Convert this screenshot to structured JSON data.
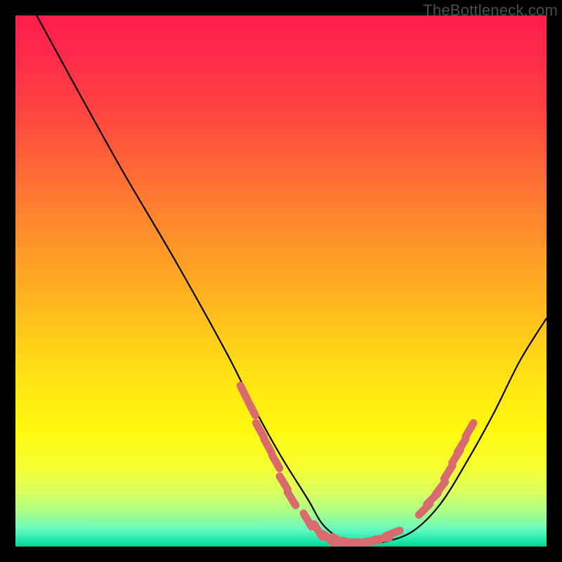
{
  "watermark": "TheBottleneck.com",
  "colors": {
    "background": "#000000",
    "curve": "#000000",
    "marker_fill": "#d96a6e",
    "watermark": "#4d4d4d"
  },
  "chart_data": {
    "type": "line",
    "title": "",
    "xlabel": "",
    "ylabel": "",
    "xlim": [
      0,
      100
    ],
    "ylim": [
      0,
      100
    ],
    "grid": false,
    "legend": false,
    "annotations": [],
    "series": [
      {
        "name": "bottleneck-curve",
        "x": [
          4,
          10,
          20,
          30,
          40,
          45,
          50,
          55,
          58,
          62,
          65,
          70,
          75,
          80,
          85,
          90,
          95,
          100
        ],
        "y": [
          100,
          89,
          71,
          54,
          36,
          26,
          17,
          9,
          4,
          1,
          0.5,
          1,
          3,
          8,
          16,
          25,
          35,
          43
        ]
      }
    ],
    "markers": {
      "comment": "Approximate pill-shaped marker positions (x, y in 0-100 chart coords) where the curve is highlighted near the trough.",
      "points": [
        {
          "x": 43,
          "y": 29
        },
        {
          "x": 44.5,
          "y": 26
        },
        {
          "x": 46,
          "y": 22
        },
        {
          "x": 47.5,
          "y": 19
        },
        {
          "x": 49,
          "y": 16
        },
        {
          "x": 50.5,
          "y": 12
        },
        {
          "x": 52,
          "y": 9
        },
        {
          "x": 55,
          "y": 5
        },
        {
          "x": 57,
          "y": 3
        },
        {
          "x": 59,
          "y": 1.5
        },
        {
          "x": 61,
          "y": 1
        },
        {
          "x": 63,
          "y": 0.8
        },
        {
          "x": 65,
          "y": 0.8
        },
        {
          "x": 67,
          "y": 1
        },
        {
          "x": 69,
          "y": 1.5
        },
        {
          "x": 71,
          "y": 2.5
        },
        {
          "x": 77,
          "y": 7
        },
        {
          "x": 78.5,
          "y": 9
        },
        {
          "x": 80,
          "y": 11
        },
        {
          "x": 81.5,
          "y": 14
        },
        {
          "x": 83,
          "y": 17
        },
        {
          "x": 84,
          "y": 19
        },
        {
          "x": 85.5,
          "y": 22
        }
      ]
    }
  }
}
